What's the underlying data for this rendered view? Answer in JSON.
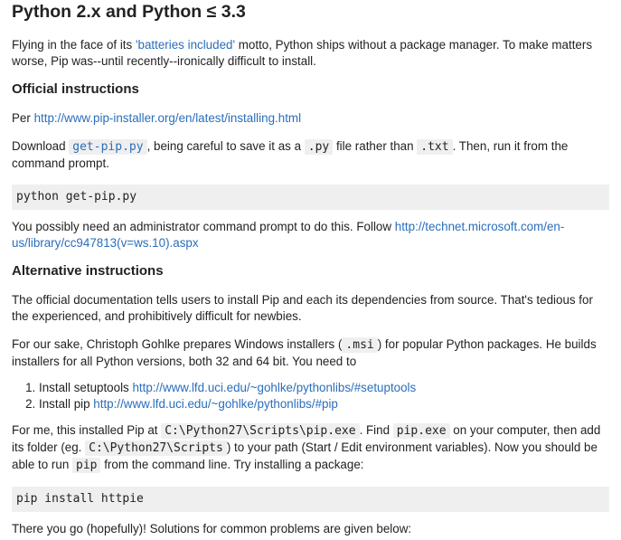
{
  "title": "Python 2.x and Python ≤ 3.3",
  "intro": {
    "pre": "Flying in the face of its ",
    "link": "'batteries included'",
    "post": " motto, Python ships without a package manager. To make matters worse, Pip was--until recently--ironically difficult to install."
  },
  "official": {
    "heading": "Official instructions",
    "per_label": "Per ",
    "per_link": "http://www.pip-installer.org/en/latest/installing.html",
    "download_pre": "Download ",
    "download_code": "get-pip.py",
    "download_mid1": ", being careful to save it as a ",
    "download_ext1": ".py",
    "download_mid2": " file rather than ",
    "download_ext2": ".txt",
    "download_post": ". Then, run it from the command prompt.",
    "command": "python get-pip.py",
    "admin_pre": "You possibly need an administrator command prompt to do this. Follow ",
    "admin_link": "http://technet.microsoft.com/en-us/library/cc947813(v=ws.10).aspx"
  },
  "alternative": {
    "heading": "Alternative instructions",
    "para1": "The official documentation tells users to install Pip and each its dependencies from source. That's tedious for the experienced, and prohibitively difficult for newbies.",
    "para2_pre": "For our sake, Christoph Gohlke prepares Windows installers (",
    "para2_code": ".msi",
    "para2_post": ") for popular Python packages. He builds installers for all Python versions, both 32 and 64 bit. You need to",
    "steps": [
      {
        "label": "Install setuptools ",
        "link": "http://www.lfd.uci.edu/~gohlke/pythonlibs/#setuptools"
      },
      {
        "label": "Install pip ",
        "link": "http://www.lfd.uci.edu/~gohlke/pythonlibs/#pip"
      }
    ],
    "para3_a": "For me, this installed Pip at ",
    "para3_code1": "C:\\Python27\\Scripts\\pip.exe",
    "para3_b": ". Find ",
    "para3_code2": "pip.exe",
    "para3_c": " on your computer, then add its folder (eg. ",
    "para3_code3": "C:\\Python27\\Scripts",
    "para3_d": ") to your path (Start / Edit environment variables). Now you should be able to run ",
    "para3_code4": "pip",
    "para3_e": " from the command line. Try installing a package:",
    "command": "pip install httpie",
    "closing": "There you go (hopefully)! Solutions for common problems are given below:"
  },
  "colors": {
    "link": "#2a6ebb",
    "code_bg": "#efefef",
    "text": "#222222"
  }
}
